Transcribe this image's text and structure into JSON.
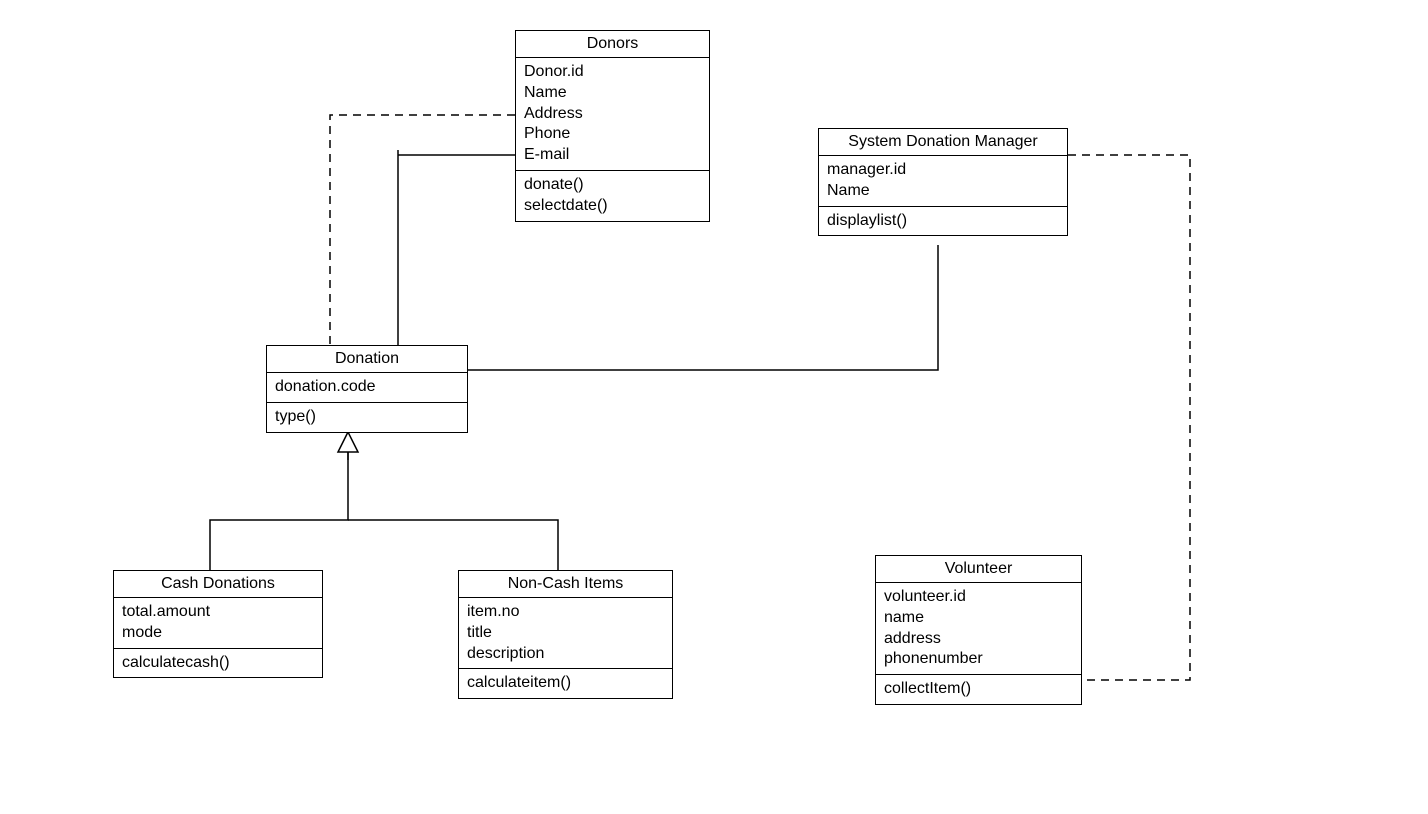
{
  "classes": {
    "donors": {
      "title": "Donors",
      "attributes": [
        "Donor.id",
        "Name",
        "Address",
        "Phone",
        "E-mail"
      ],
      "methods": [
        "donate()",
        "selectdate()"
      ]
    },
    "manager": {
      "title": "System Donation Manager",
      "attributes": [
        "manager.id",
        "Name"
      ],
      "methods": [
        "displaylist()"
      ]
    },
    "donation": {
      "title": "Donation",
      "attributes": [
        "donation.code"
      ],
      "methods": [
        "type()"
      ]
    },
    "cash": {
      "title": "Cash Donations",
      "attributes": [
        "total.amount",
        "mode"
      ],
      "methods": [
        "calculatecash()"
      ]
    },
    "noncash": {
      "title": "Non-Cash Items",
      "attributes": [
        "item.no",
        "title",
        "description"
      ],
      "methods": [
        "calculateitem()"
      ]
    },
    "volunteer": {
      "title": "Volunteer",
      "attributes": [
        "volunteer.id",
        "name",
        "address",
        "phonenumber"
      ],
      "methods": [
        "collectItem()"
      ]
    }
  }
}
